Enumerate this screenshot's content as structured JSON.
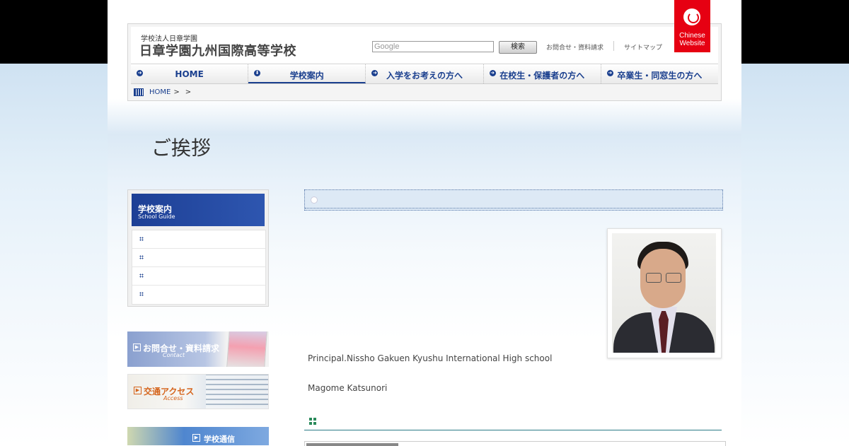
{
  "header": {
    "school_sub": "学校法人日章学園",
    "school_name": "日章学園九州国際高等学校",
    "search_placeholder": "Google",
    "search_button": "検索",
    "contact_link": "お問合せ・資料請求",
    "sitemap_link": "サイトマップ",
    "chinese_badge": {
      "line1": "Chinese",
      "line2": "Website"
    }
  },
  "nav": [
    {
      "label": "HOME",
      "active": false
    },
    {
      "label": "学校案内",
      "active": true
    },
    {
      "label": "入学をお考えの方へ",
      "active": false
    },
    {
      "label": "在校生・保護者の方へ",
      "active": false
    },
    {
      "label": "卒業生・同窓生の方へ",
      "active": false
    }
  ],
  "breadcrumb": {
    "home": "HOME",
    "sep1": ">",
    "sep2": ">"
  },
  "page_title": "ご挨拶",
  "sidebar": {
    "heading_ja": "学校案内",
    "heading_en": "School Guide",
    "items": [
      "",
      "",
      "",
      ""
    ]
  },
  "banners": {
    "contact": {
      "ja": "お問合せ・資料請求",
      "en": "Contact"
    },
    "access": {
      "ja": "交通アクセス",
      "en": "Access"
    },
    "news": {
      "ja": "学校通信"
    }
  },
  "main": {
    "principal_title": "Principal.Nissho Gakuen Kyushu International High school",
    "principal_name": "Magome Katsunori"
  },
  "colors": {
    "brand_blue": "#1a3f8e",
    "badge_red": "#e60012",
    "accent_teal": "#2a7a86"
  }
}
